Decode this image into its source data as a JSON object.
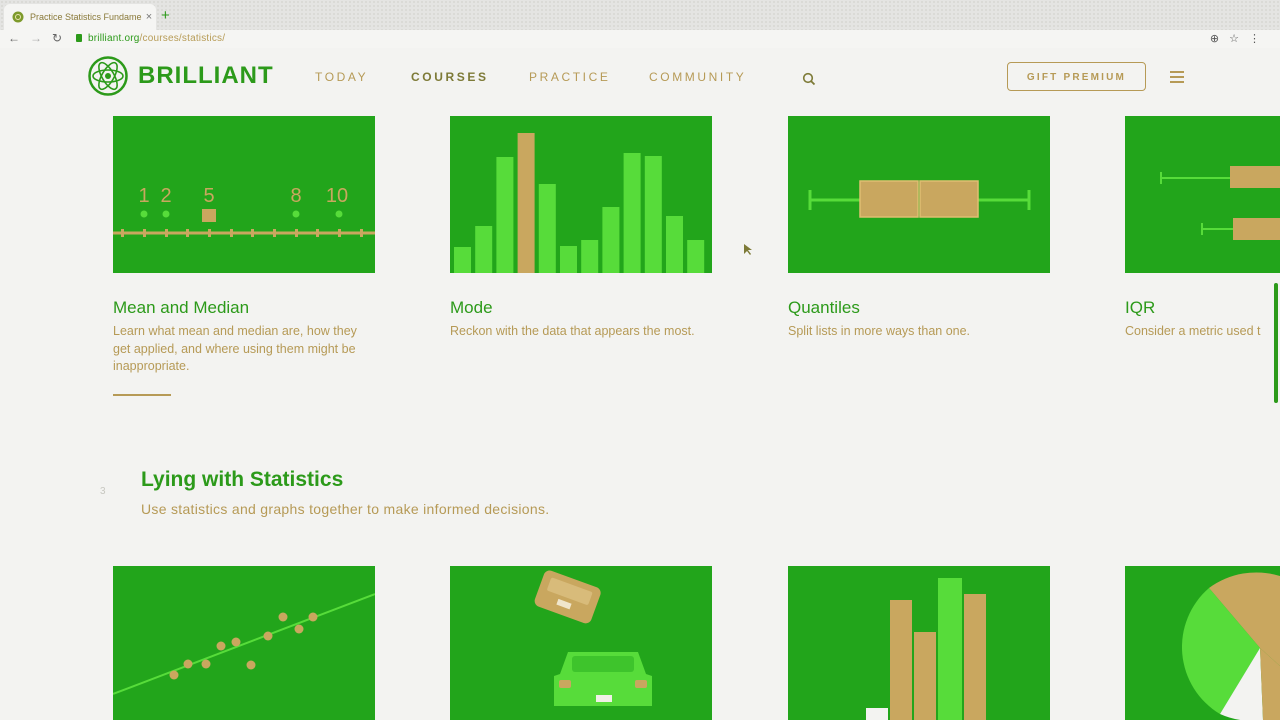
{
  "browser": {
    "tab_title": "Practice Statistics Fundamenta",
    "tab_close": "×",
    "new_tab": "+",
    "url_host": "brilliant.org",
    "url_path": "/courses/statistics/",
    "back_icon": "arrow-left-icon",
    "forward_icon": "arrow-right-icon",
    "reload_icon": "reload-icon"
  },
  "header": {
    "logo_text": "BRILLIANT",
    "nav": [
      "TODAY",
      "COURSES",
      "PRACTICE",
      "COMMUNITY"
    ],
    "active_nav": "COURSES",
    "gift_label": "GIFT PREMIUM",
    "search_icon": "search-icon",
    "menu_icon": "hamburger-icon"
  },
  "cards_top": [
    {
      "title": "Mean and Median",
      "desc": "Learn what mean and median are, how they get applied, and where using them might be inappropriate."
    },
    {
      "title": "Mode",
      "desc": "Reckon with the data that appears the most."
    },
    {
      "title": "Quantiles",
      "desc": "Split lists in more ways than one."
    },
    {
      "title": "IQR",
      "desc": "Consider a metric used t"
    }
  ],
  "mean_figure": {
    "labels": [
      "1",
      "2",
      "5",
      "8",
      "10"
    ]
  },
  "mode_figure": {
    "bars": [
      0.17,
      0.31,
      0.77,
      0.93,
      0.59,
      0.18,
      0.22,
      0.44,
      0.8,
      0.78,
      0.38,
      0.22
    ],
    "highlight": 3
  },
  "section": {
    "number": "3",
    "title": "Lying with Statistics",
    "subtitle": "Use statistics and graphs together to make informed decisions."
  },
  "colors": {
    "green": "#22a51b",
    "light_green": "#57dc3a",
    "tan": "#c9a75f",
    "brand": "#2c9a1a",
    "gold": "#b69a56"
  }
}
